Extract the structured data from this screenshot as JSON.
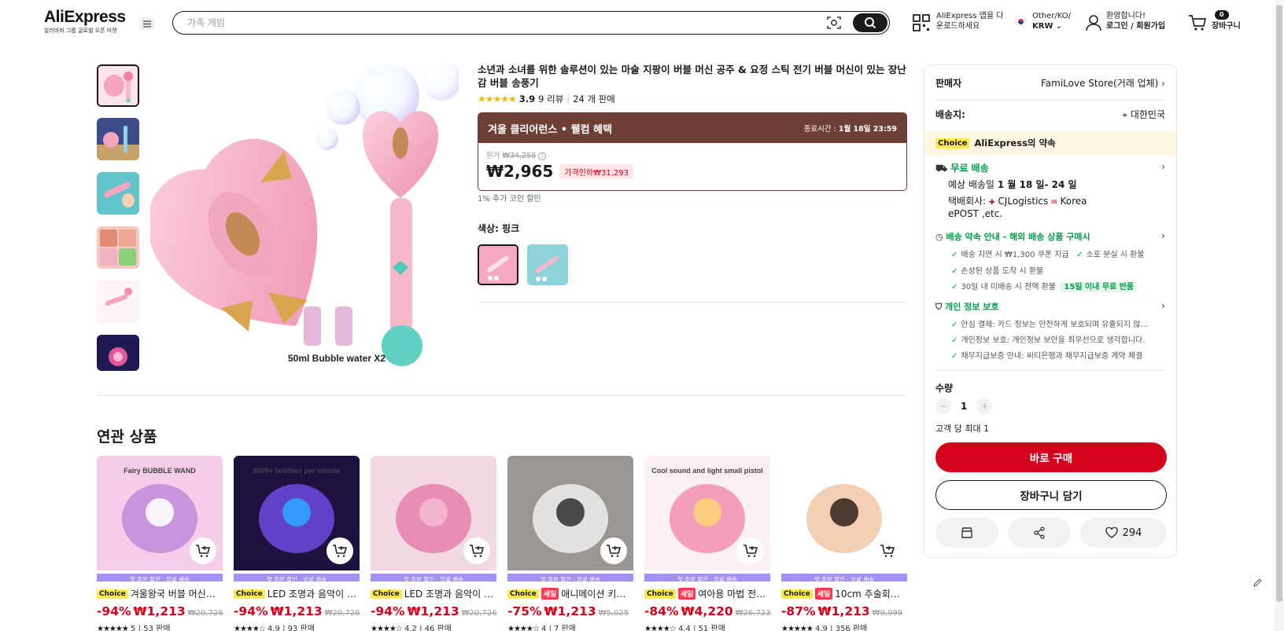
{
  "header": {
    "logo": "AliExpress",
    "logo_sub": "알리바바 그룹 글로벌 오픈 마켓",
    "search_placeholder": "가족 게임",
    "app_line1": "AliExpress 앱을 다",
    "app_line2": "운로드하세요",
    "region_line1": "Other/KO/",
    "region_line2": "KRW",
    "account_line1": "환영합니다!",
    "account_line2": "로그인 / 회원가입",
    "cart_count": "0",
    "cart_label": "장바구니"
  },
  "product": {
    "title": "소년과 소녀를 위한 솔루션이 있는 마술 지팡이 버블 머신 공주 & 요정 스틱 전기 버블 머신이 있는 장난감 버블 송풍기",
    "stars": "★★★★★",
    "rating": "3.9",
    "reviews": "9 리뷰",
    "sold": "24 개 판매",
    "image_caption": "50ml Bubble water X2"
  },
  "promo": {
    "title": "겨울 클리어런스 • 웰컴 혜택",
    "end_label": "종료시간 :",
    "end_time": "1월 18일 23:59",
    "orig_label": "원가",
    "orig_price": "₩34,258",
    "price": "₩2,965",
    "discount": "가격인하₩31,293",
    "coin_text": "1% 추가 코인 할인"
  },
  "options": {
    "label": "색상: 핑크"
  },
  "sidebar": {
    "seller_label": "판매자",
    "seller_name": "FamiLove Store(거래 업체)",
    "ship_to_label": "배송지:",
    "ship_to": "대한민국",
    "choice_badge": "Choice",
    "choice_text": "AliExpress의 약속",
    "free_ship": "무료 배송",
    "est_label": "예상 배송일",
    "est_date": "1 월 18 일- 24 일",
    "carrier_label": "택배회사:",
    "carrier1": "CJLogistics",
    "carrier2": "Korea",
    "carrier3": "ePOST ,etc.",
    "delivery_title": "배송 약속 안내 - 해외 배송 상품 구매시",
    "delivery_items": [
      "배송 지연 시 ₩1,300 쿠폰 지급",
      "소포 분실 시 환불",
      "손상된 상품 도착 시 환불",
      "30일 내 미배송 시 전액 환불"
    ],
    "return_badge": "15일 이내 무료 반품",
    "privacy_title": "개인 정보 보호",
    "privacy_items": [
      "안심 결제: 카드 정보는 안전하게 보호되며 유출되지 않...",
      "개인정보 보호: 개인정보 보안을 최우선으로 생각합니다.",
      "채무지급보증 안내: 씨티은행과 채무지급보증 계약 체결"
    ],
    "qty_label": "수량",
    "qty_value": "1",
    "qty_limit": "고객 당 최대 1",
    "buy_now": "바로 구매",
    "add_cart": "장바구니 담기",
    "wishlist_count": "294"
  },
  "related": {
    "title": "연관 상품",
    "shipping_strip": "첫 주문 할인 · 무료 배송",
    "items": [
      {
        "badge": "Choice",
        "sale": "",
        "name": "겨울왕국 버블 머신에...",
        "discount": "-94%",
        "price": "₩1,213",
        "old": "₩20,726",
        "stars": "★★★★★",
        "rating": "5",
        "sold": "53 판매"
      },
      {
        "badge": "Choice",
        "sale": "",
        "name": "LED 조명과 음악이 포...",
        "discount": "-94%",
        "price": "₩1,213",
        "old": "₩20,726",
        "stars": "★★★★☆",
        "rating": "4.9",
        "sold": "93 판매"
      },
      {
        "badge": "Choice",
        "sale": "",
        "name": "LED 조명과 음악이 있...",
        "discount": "-94%",
        "price": "₩1,213",
        "old": "₩20,726",
        "stars": "★★★★☆",
        "rating": "4.2",
        "sold": "46 판매"
      },
      {
        "badge": "Choice",
        "sale": "세일",
        "name": "애니메이션 키체...",
        "discount": "-75%",
        "price": "₩1,213",
        "old": "₩5,025",
        "stars": "★★★★☆",
        "rating": "4",
        "sold": "7 판매"
      },
      {
        "badge": "Choice",
        "sale": "세일",
        "name": "여아용 마법 전기...",
        "discount": "-84%",
        "price": "₩4,220",
        "old": "₩26,723",
        "stars": "★★★★☆",
        "rating": "4.4",
        "sold": "51 판매"
      },
      {
        "badge": "Choice",
        "sale": "세일",
        "name": "10cm 주술회전 ...",
        "discount": "-87%",
        "price": "₩1,213",
        "old": "₩9,999",
        "stars": "★★★★★",
        "rating": "4.9",
        "sold": "356 판매"
      }
    ],
    "img_texts": [
      "Fairy BUBBLE WAND",
      "6000+ bubbles per minute",
      "",
      "",
      "Cool sound and light small pistol",
      ""
    ]
  }
}
